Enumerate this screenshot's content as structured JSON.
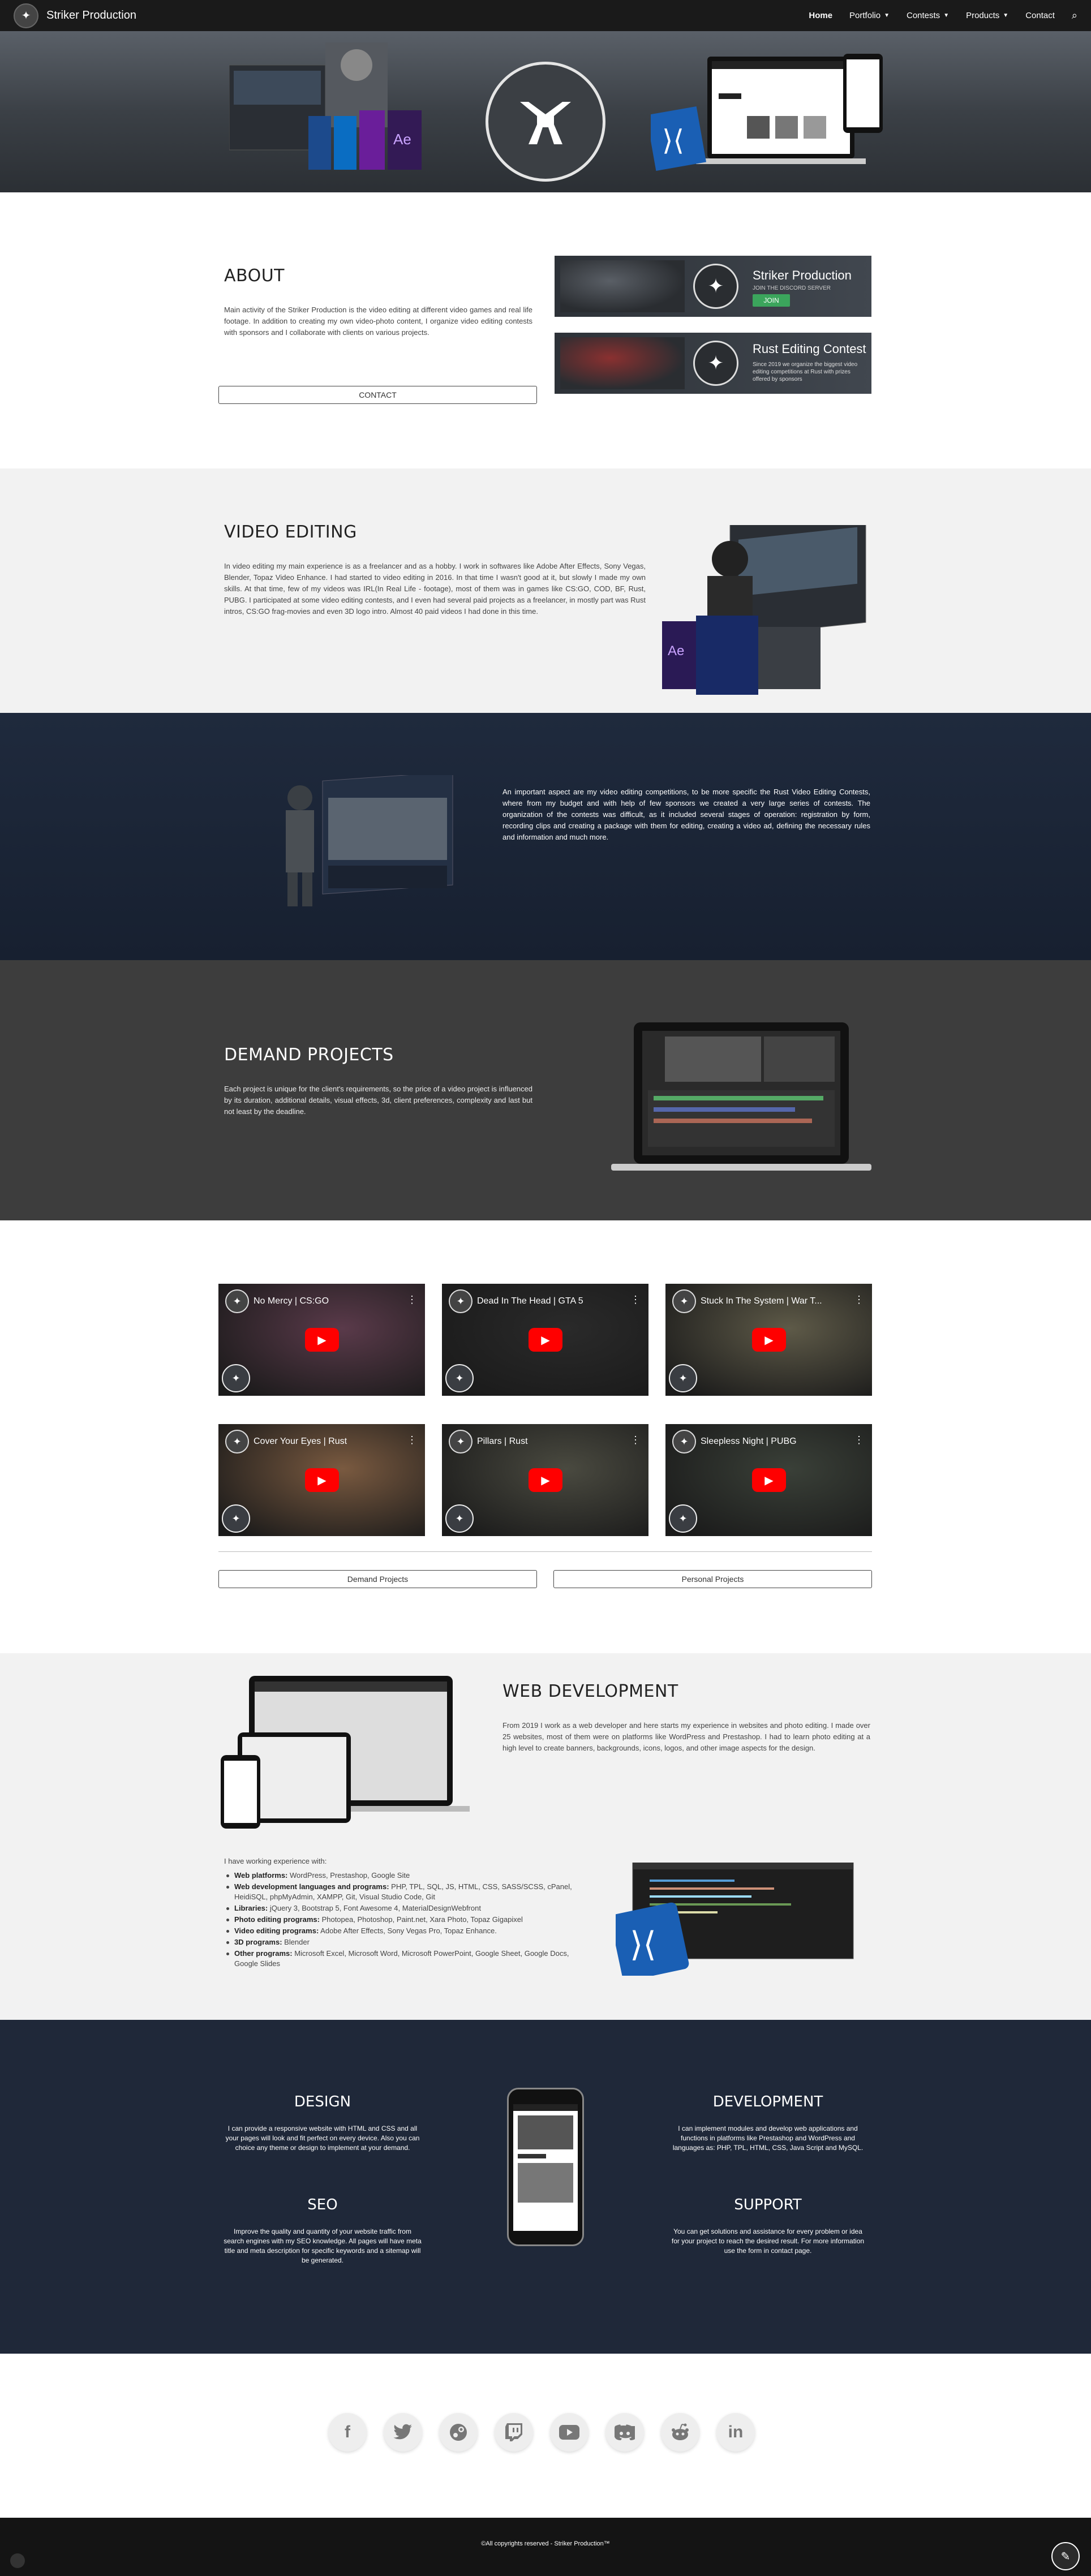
{
  "nav": {
    "brand": "Striker Production",
    "items": [
      {
        "label": "Home"
      },
      {
        "label": "Portfolio"
      },
      {
        "label": "Contests"
      },
      {
        "label": "Products"
      },
      {
        "label": "Contact"
      }
    ]
  },
  "about": {
    "title": "ABOUT",
    "text": "Main activity of the Striker Production is the video editing at different video games and real life footage. In addition to creating my own video-photo content, I organize video editing contests with sponsors and I collaborate with clients on various projects.",
    "contact_label": "CONTACT",
    "banner1": {
      "title": "Striker Production",
      "subtitle": "JOIN THE DISCORD SERVER",
      "join": "JOIN"
    },
    "banner2": {
      "title": "Rust Editing Contest",
      "desc": "Since 2019 we organize the biggest video editing competitions at Rust with prizes offered by sponsors"
    }
  },
  "video_editing": {
    "title": "VIDEO EDITING",
    "text": "In video editing my main experience is as a freelancer and as a hobby. I work in softwares like Adobe After Effects, Sony Vegas, Blender, Topaz Video Enhance. I had started to video editing in 2016. In that time I wasn't good at it, but slowly I made my own skills. At that time, few of my videos was IRL(In Real Life - footage), most of them was in games like CS:GO, COD, BF, Rust, PUBG. I participated at some video editing contests, and I even had several paid projects as a freelancer, in mostly part was Rust intros, CS:GO frag-movies and even 3D logo intro. Almost 40 paid videos I had done in this time."
  },
  "rust": {
    "text": "An important aspect are my video editing competitions, to be more specific the Rust Video Editing Contests, where from my budget and with help of few sponsors we created a very large series of contests. The organization of the contests was difficult, as it included several stages of operation: registration by form, recording clips and creating a package with them for editing, creating a video ad, defining the necessary rules and information and much more."
  },
  "demand": {
    "title": "DEMAND PROJECTS",
    "text": "Each project is unique for the client's requirements, so the price of a video project is influenced by its duration, additional details, visual effects, 3d, client preferences, complexity and last but not least by the deadline."
  },
  "videos": {
    "items": [
      {
        "title": "No Mercy | CS:GO",
        "color": "#5a3a4a"
      },
      {
        "title": "Dead In The Head | GTA 5",
        "color": "#2a2a2a"
      },
      {
        "title": "Stuck In The System | War T...",
        "color": "#5e5a48"
      },
      {
        "title": "Cover Your Eyes | Rust",
        "color": "#7a5a40"
      },
      {
        "title": "Pillars | Rust",
        "color": "#4a4a40"
      },
      {
        "title": "Sleepless Night | PUBG",
        "color": "#3a4038"
      }
    ],
    "btn_demand": "Demand Projects",
    "btn_personal": "Personal Projects"
  },
  "webdev": {
    "title": "WEB DEVELOPMENT",
    "text": "From 2019 I work as a web developer and here starts my experience in websites and photo editing. I made over 25 websites, most of them were on platforms like WordPress and Prestashop. I had to learn photo editing at a high level to create banners, backgrounds, icons, logos, and other image aspects for the design.",
    "list_intro": "I have working experience with:",
    "list": [
      {
        "k": "Web platforms:",
        "v": " WordPress, Prestashop, Google Site"
      },
      {
        "k": "Web development languages and programs:",
        "v": " PHP, TPL, SQL, JS, HTML, CSS, SASS/SCSS, cPanel, HeidiSQL, phpMyAdmin, XAMPP, Git, Visual Studio Code, Git"
      },
      {
        "k": "Libraries:",
        "v": " jQuery 3, Bootstrap 5, Font Awesome 4, MaterialDesignWebfront"
      },
      {
        "k": "Photo editing programs:",
        "v": " Photopea, Photoshop, Paint.net, Xara Photo, Topaz Gigapixel"
      },
      {
        "k": "Video editing programs:",
        "v": " Adobe After Effects, Sony Vegas Pro, Topaz Enhance."
      },
      {
        "k": "3D programs:",
        "v": " Blender"
      },
      {
        "k": "Other programs:",
        "v": " Microsoft Excel, Microsoft Word, Microsoft PowerPoint, Google Sheet, Google Docs, Google Slides"
      }
    ]
  },
  "services": {
    "design": {
      "title": "DESIGN",
      "text": "I can provide a responsive website with HTML and CSS and all your pages will look and fit perfect on every device. Also you can choice any theme or design to implement at your demand."
    },
    "development": {
      "title": "DEVELOPMENT",
      "text": "I can implement modules and develop web applications and functions in platforms like Prestashop and WordPress and languages as: PHP, TPL, HTML, CSS, Java Script and MySQL."
    },
    "seo": {
      "title": "SEO",
      "text": "Improve the quality and quantity of your website traffic from search engines with my SEO knowledge. All pages will have meta title and meta description for specific keywords and a sitemap will be generated."
    },
    "support": {
      "title": "SUPPORT",
      "text": "You can get solutions and assistance for every problem or idea for your project to reach the desired result. For more information use the form in contact page."
    }
  },
  "social": [
    {
      "icon": "facebook-icon",
      "glyph": "f"
    },
    {
      "icon": "twitter-icon",
      "glyph": "t"
    },
    {
      "icon": "steam-icon",
      "glyph": "⚙"
    },
    {
      "icon": "twitch-icon",
      "glyph": "▣"
    },
    {
      "icon": "youtube-icon",
      "glyph": "▶"
    },
    {
      "icon": "discord-icon",
      "glyph": "◉"
    },
    {
      "icon": "reddit-icon",
      "glyph": "◎"
    },
    {
      "icon": "linkedin-icon",
      "glyph": "in"
    }
  ],
  "footer": {
    "text": "©All copyrights reserved - Striker Production™"
  }
}
